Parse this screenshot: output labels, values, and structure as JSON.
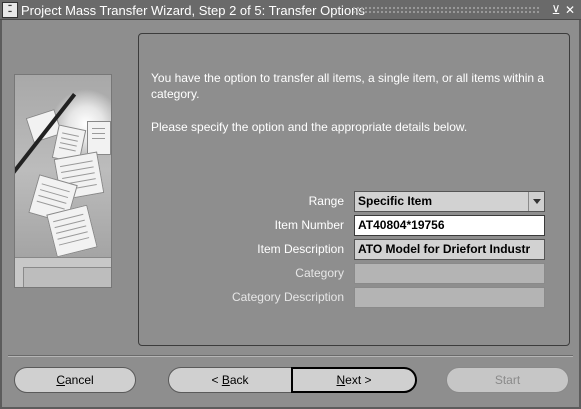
{
  "window": {
    "title": "Project Mass Transfer Wizard, Step 2 of 5: Transfer Options",
    "icon_name": "oracle-forms-icon",
    "minimize_glyph": "⊻",
    "close_glyph": "✕"
  },
  "content": {
    "paragraph1": "You have the option to transfer all items, a single item, or all items within a category.",
    "paragraph2": "Please specify the option and the appropriate details below."
  },
  "form": {
    "range": {
      "label": "Range",
      "value": "Specific Item"
    },
    "item_number": {
      "label": "Item Number",
      "value": "AT40804*19756"
    },
    "item_description": {
      "label": "Item Description",
      "value": "ATO Model for Driefort Industr"
    },
    "category": {
      "label": "Category",
      "value": ""
    },
    "category_description": {
      "label": "Category Description",
      "value": ""
    }
  },
  "buttons": {
    "cancel": {
      "mnemonic": "C",
      "rest": "ancel"
    },
    "back": {
      "prefix": "< ",
      "mnemonic": "B",
      "rest": "ack"
    },
    "next": {
      "mnemonic": "N",
      "rest": "ext >"
    },
    "start": {
      "label": "Start"
    }
  },
  "colors": {
    "background": "#8e8e8e",
    "title_bar": "#6a6a6a",
    "input_white": "#ffffff",
    "input_disabled": "#b4b4b4"
  }
}
